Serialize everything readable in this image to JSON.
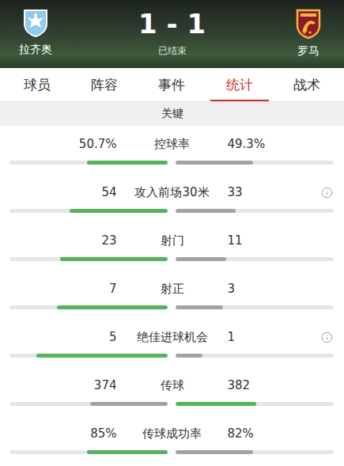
{
  "match": {
    "home": {
      "name": "拉齐奥"
    },
    "away": {
      "name": "罗马"
    },
    "score": "1 - 1",
    "status": "已结束"
  },
  "tabs": [
    {
      "label": "球员",
      "selected": false
    },
    {
      "label": "阵容",
      "selected": false
    },
    {
      "label": "事件",
      "selected": false
    },
    {
      "label": "统计",
      "selected": true
    },
    {
      "label": "战术",
      "selected": false
    }
  ],
  "section": {
    "title": "关键"
  },
  "stats": [
    {
      "label": "控球率",
      "home": "50.7%",
      "away": "49.3%",
      "home_level": 0.51,
      "away_level": 0.49,
      "leader": "home",
      "info": false
    },
    {
      "label": "攻入前场30米",
      "home": "54",
      "away": "33",
      "home_level": 0.62,
      "away_level": 0.38,
      "leader": "home",
      "info": true
    },
    {
      "label": "射门",
      "home": "23",
      "away": "11",
      "home_level": 0.68,
      "away_level": 0.32,
      "leader": "home",
      "info": false
    },
    {
      "label": "射正",
      "home": "7",
      "away": "3",
      "home_level": 0.7,
      "away_level": 0.3,
      "leader": "home",
      "info": false
    },
    {
      "label": "绝佳进球机会",
      "home": "5",
      "away": "1",
      "home_level": 0.83,
      "away_level": 0.17,
      "leader": "home",
      "info": true
    },
    {
      "label": "传球",
      "home": "374",
      "away": "382",
      "home_level": 0.49,
      "away_level": 0.51,
      "leader": "away",
      "info": false
    },
    {
      "label": "传球成功率",
      "home": "85%",
      "away": "82%",
      "home_level": 0.51,
      "away_level": 0.49,
      "leader": "home",
      "info": false
    }
  ]
}
